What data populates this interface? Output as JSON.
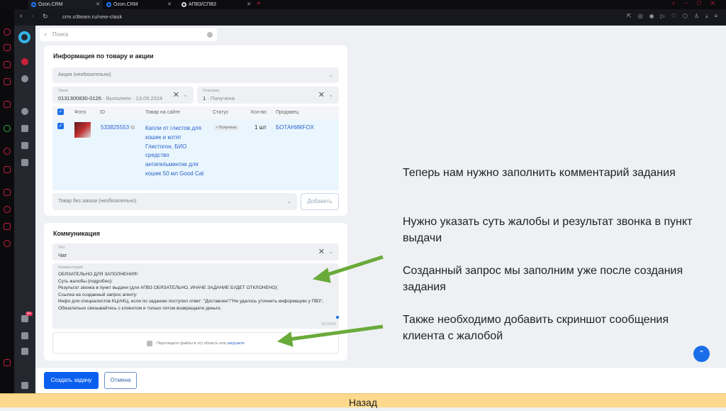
{
  "browser": {
    "tabs": [
      {
        "title": "Ozon.CRM"
      },
      {
        "title": "Ozon.CRM"
      },
      {
        "title": "АПВЗ/СПВЗ"
      }
    ],
    "url": "crm.o3team.ru/new-ctask"
  },
  "search": {
    "placeholder": "Поиск"
  },
  "product_section": {
    "title": "Информация по товару и акции",
    "promo": {
      "placeholder": "Акция (необязательно)"
    },
    "order": {
      "label": "Заказ",
      "value_id": "0131300830-0126",
      "value_status": " · Выполнен · 13.09.2024"
    },
    "package": {
      "label": "Упаковка",
      "value_id": "1",
      "value_status": " · Получена"
    },
    "table": {
      "headers": [
        "Фото",
        "ID",
        "Товар на сайте",
        "Статус",
        "Кол-во",
        "Продавец"
      ],
      "rows": [
        {
          "id": "533825553",
          "product": "Капли от глистов для кошек и котят Глистогон, БИО средство антигельминтик для кошек 50 мл Good Cat",
          "status": "• Получена",
          "qty": "1 шт",
          "seller": "БОТАНИКFOX"
        }
      ]
    },
    "no_order": {
      "placeholder": "Товар без заказа (необязательно)"
    },
    "add_label": "Добавить"
  },
  "communication": {
    "title": "Коммуникация",
    "type": {
      "label": "Тип",
      "value": "Чат"
    },
    "comment": {
      "label": "Комментарий",
      "lines": [
        "ОБЯЗАТЕЛЬНО ДЛЯ ЗАПОЛНЕНИЯ!",
        "Суть жалобы (подробно):",
        "Результат звонка в пункт выдачи (для АПВЗ ОБЯЗАТЕЛЬНО, ИНАЧЕ ЗАДАНИЕ БУДЕТ ОТКЛОНЕНО):",
        "Ссылка на созданный запрос агенту:",
        "Инфо для специалистов КЦ/АКЦ, если по заданию поступил ответ: \"Доставлен\"/\"Не удалось уточнить информацию у ПВЗ\", Обязательно связывайтесь с клиентом и только потом возвращаете деньги."
      ],
      "counter": "361/2000"
    },
    "upload": {
      "text": "Перетащите файлы в эту область или ",
      "link": "загрузите"
    }
  },
  "actions": {
    "create": "Создать задачу",
    "cancel": "Отмена"
  },
  "sidebar": {
    "badge": "9+"
  },
  "notes": [
    "Теперь нам нужно заполнить комментарий задания",
    "Нужно указать суть жалобы и результат звонка в пункт выдачи",
    "Созданный запрос мы заполним уже после создания задания",
    "Также необходимо добавить скриншот сообщения клиента с жалобой"
  ],
  "footer": {
    "back": "Назад"
  },
  "colors": {
    "accent": "#1a6fe8",
    "arrow": "#6aaa3a",
    "footer": "#fcd98c",
    "sidebar": "#24272d"
  }
}
